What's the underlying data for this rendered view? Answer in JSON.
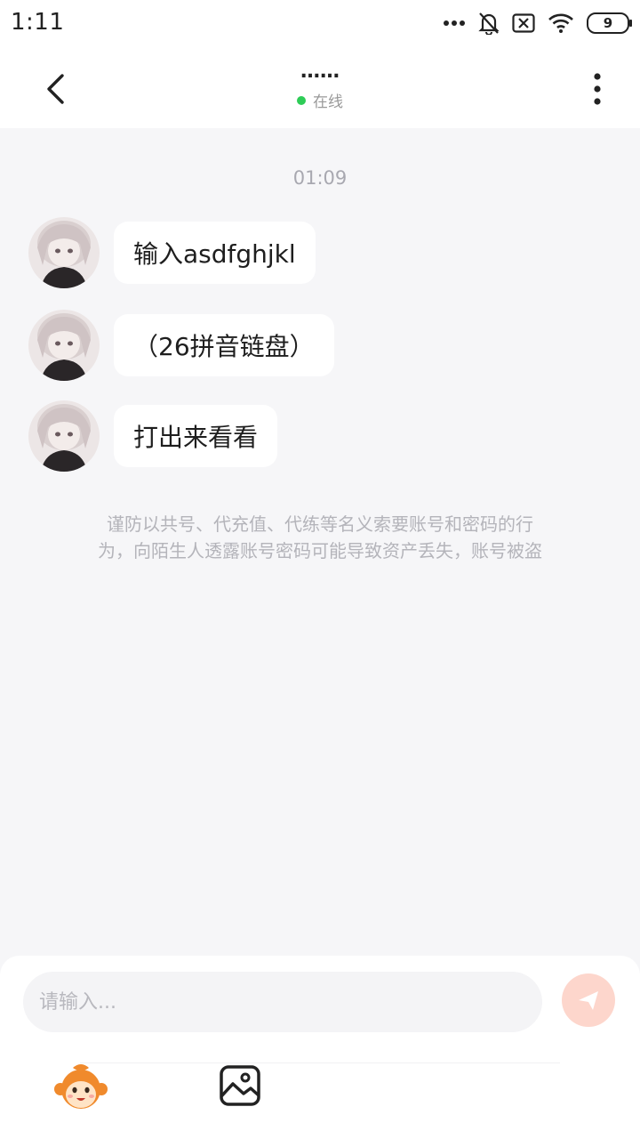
{
  "status_bar": {
    "time": "1:11",
    "battery_level": "9",
    "icons": [
      "more-dots-icon",
      "bell-muted-icon",
      "sim-x-icon",
      "wifi-icon",
      "battery-icon"
    ]
  },
  "header": {
    "back_icon": "chevron-left-icon",
    "title": "……",
    "online_status": "在线",
    "online_color": "#2ecc57",
    "more_icon": "vertical-dots-icon"
  },
  "chat": {
    "timestamp": "01:09",
    "messages": [
      {
        "text": "输入asdfghjkl"
      },
      {
        "text": "（26拼音链盘）"
      },
      {
        "text": "打出来看看"
      }
    ],
    "notice_line1": "谨防以共号、代充值、代练等名义索要账号和密码的行",
    "notice_line2": "为，向陌生人透露账号密码可能导致资产丢失，账号被盗"
  },
  "input_bar": {
    "placeholder": "请输入...",
    "send_icon": "send-icon",
    "send_color": "#fdd6cc",
    "tools": [
      "emoji-monkey-icon",
      "image-icon"
    ]
  }
}
